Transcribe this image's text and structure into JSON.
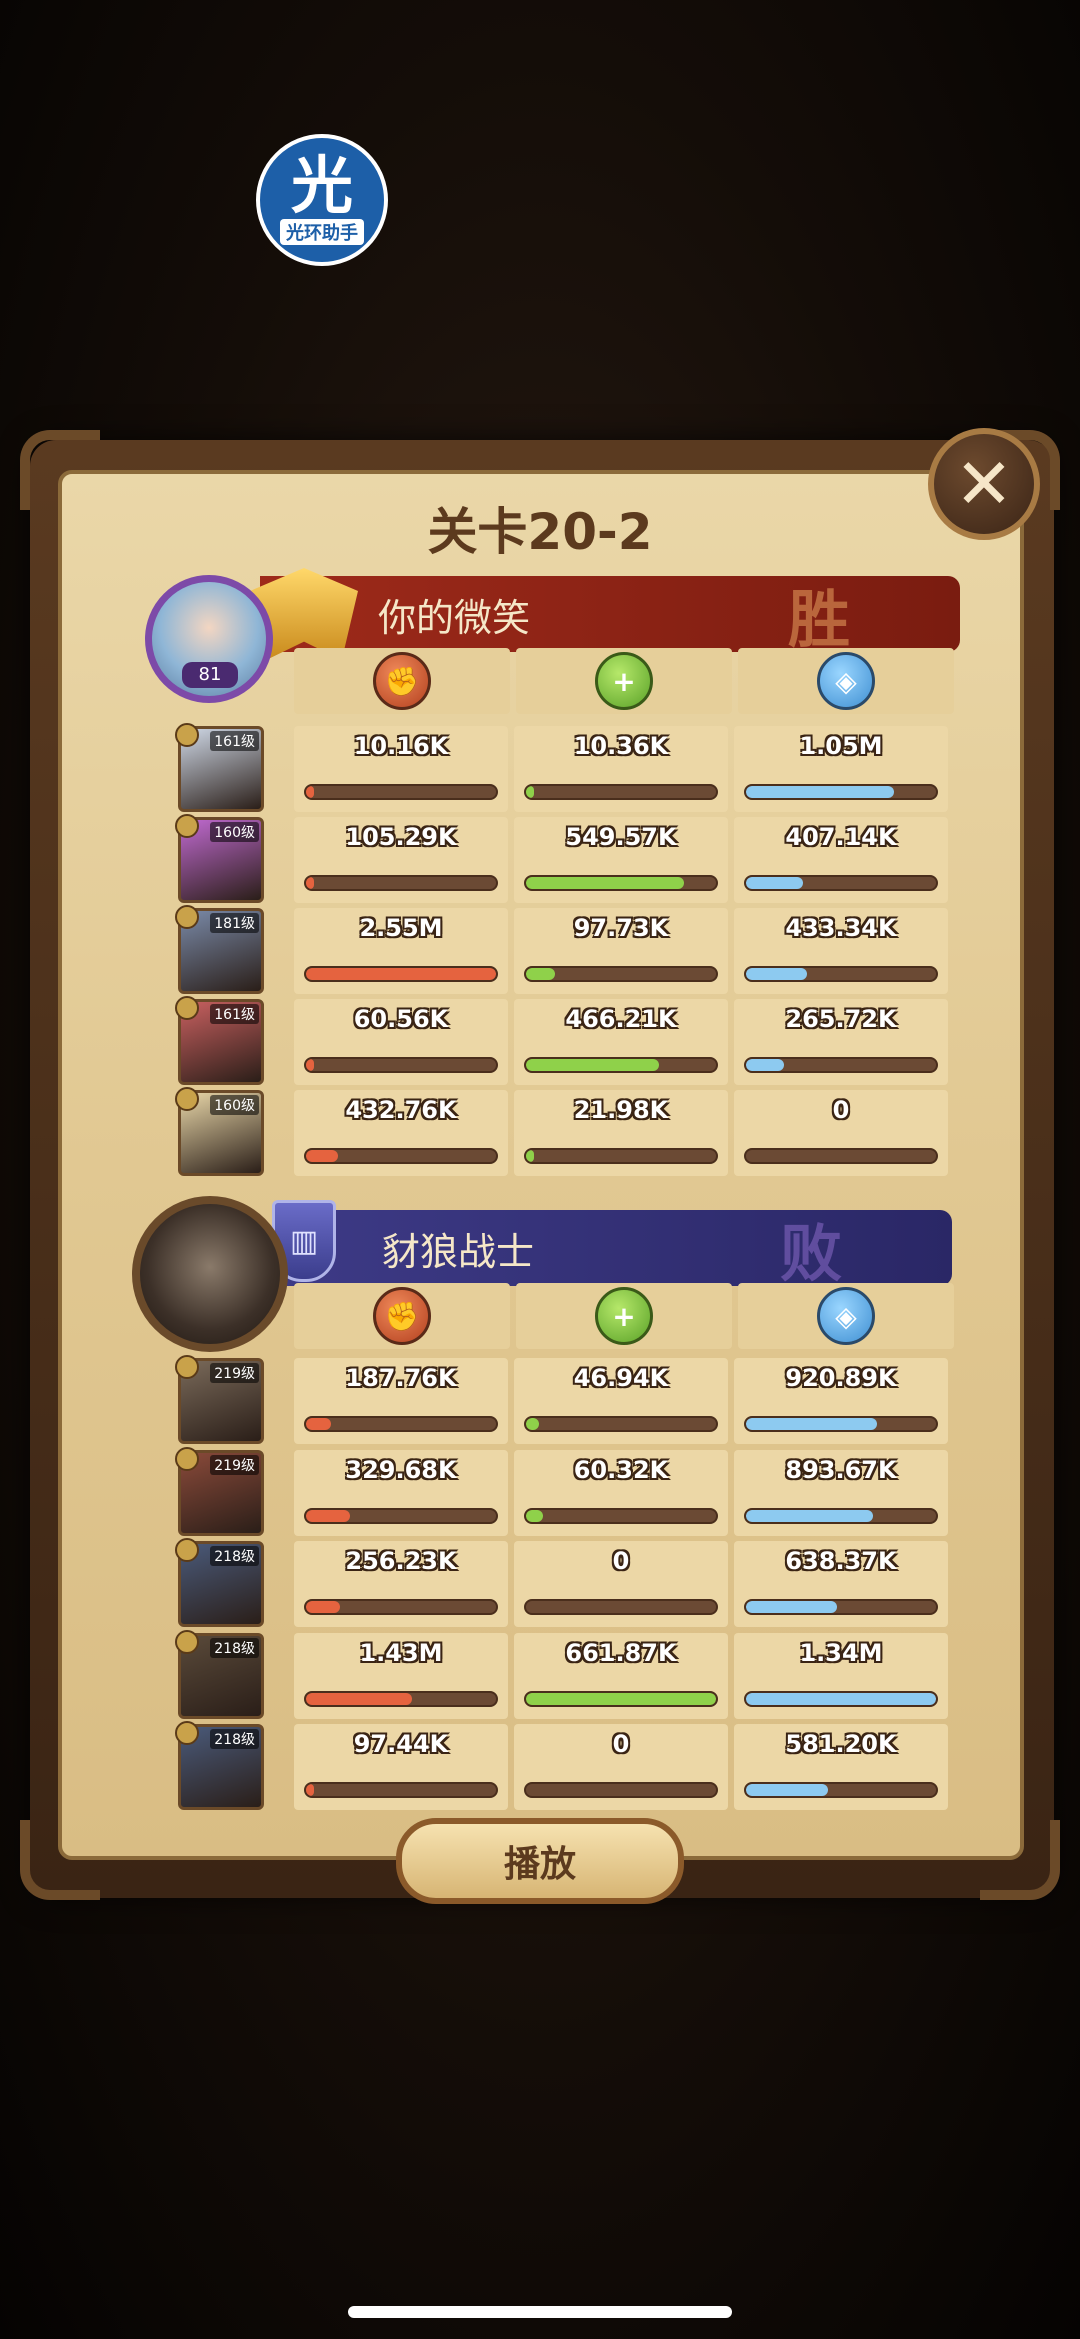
{
  "watermark": {
    "glyph": "光",
    "text": "光环助手"
  },
  "title": "关卡20-2",
  "close_glyph": "✕",
  "player": {
    "name": "你的微笑",
    "result": "胜",
    "level": "81",
    "heroes": [
      {
        "level": "161级",
        "damage": "10.16K",
        "damage_pct": 1,
        "heal": "10.36K",
        "heal_pct": 2,
        "defense": "1.05M",
        "defense_pct": 78,
        "color": "#cfd8e6"
      },
      {
        "level": "160级",
        "damage": "105.29K",
        "damage_pct": 4,
        "heal": "549.57K",
        "heal_pct": 83,
        "defense": "407.14K",
        "defense_pct": 30,
        "color": "#c06ad0"
      },
      {
        "level": "181级",
        "damage": "2.55M",
        "damage_pct": 100,
        "heal": "97.73K",
        "heal_pct": 15,
        "defense": "433.34K",
        "defense_pct": 32,
        "color": "#7a8aa8"
      },
      {
        "level": "161级",
        "damage": "60.56K",
        "damage_pct": 2,
        "heal": "466.21K",
        "heal_pct": 70,
        "defense": "265.72K",
        "defense_pct": 20,
        "color": "#c86060"
      },
      {
        "level": "160级",
        "damage": "432.76K",
        "damage_pct": 17,
        "heal": "21.98K",
        "heal_pct": 3,
        "defense": "0",
        "defense_pct": 0,
        "color": "#e8d6a8"
      }
    ]
  },
  "enemy": {
    "name": "豺狼战士",
    "result": "败",
    "heroes": [
      {
        "level": "219级",
        "damage": "187.76K",
        "damage_pct": 13,
        "heal": "46.94K",
        "heal_pct": 7,
        "defense": "920.89K",
        "defense_pct": 69,
        "color": "#7a6a5a"
      },
      {
        "level": "219级",
        "damage": "329.68K",
        "damage_pct": 23,
        "heal": "60.32K",
        "heal_pct": 9,
        "defense": "893.67K",
        "defense_pct": 67,
        "color": "#8a4a3a"
      },
      {
        "level": "218级",
        "damage": "256.23K",
        "damage_pct": 18,
        "heal": "0",
        "heal_pct": 0,
        "defense": "638.37K",
        "defense_pct": 48,
        "color": "#4a5a7a"
      },
      {
        "level": "218级",
        "damage": "1.43M",
        "damage_pct": 56,
        "heal": "661.87K",
        "heal_pct": 100,
        "defense": "1.34M",
        "defense_pct": 100,
        "color": "#5a4a3a"
      },
      {
        "level": "218级",
        "damage": "97.44K",
        "damage_pct": 4,
        "heal": "0",
        "heal_pct": 0,
        "defense": "581.20K",
        "defense_pct": 43,
        "color": "#4a5a7a"
      }
    ]
  },
  "icons": {
    "damage": "fist-icon",
    "heal": "heal-plus-icon",
    "defense": "shield-icon"
  },
  "play_button": "播放"
}
